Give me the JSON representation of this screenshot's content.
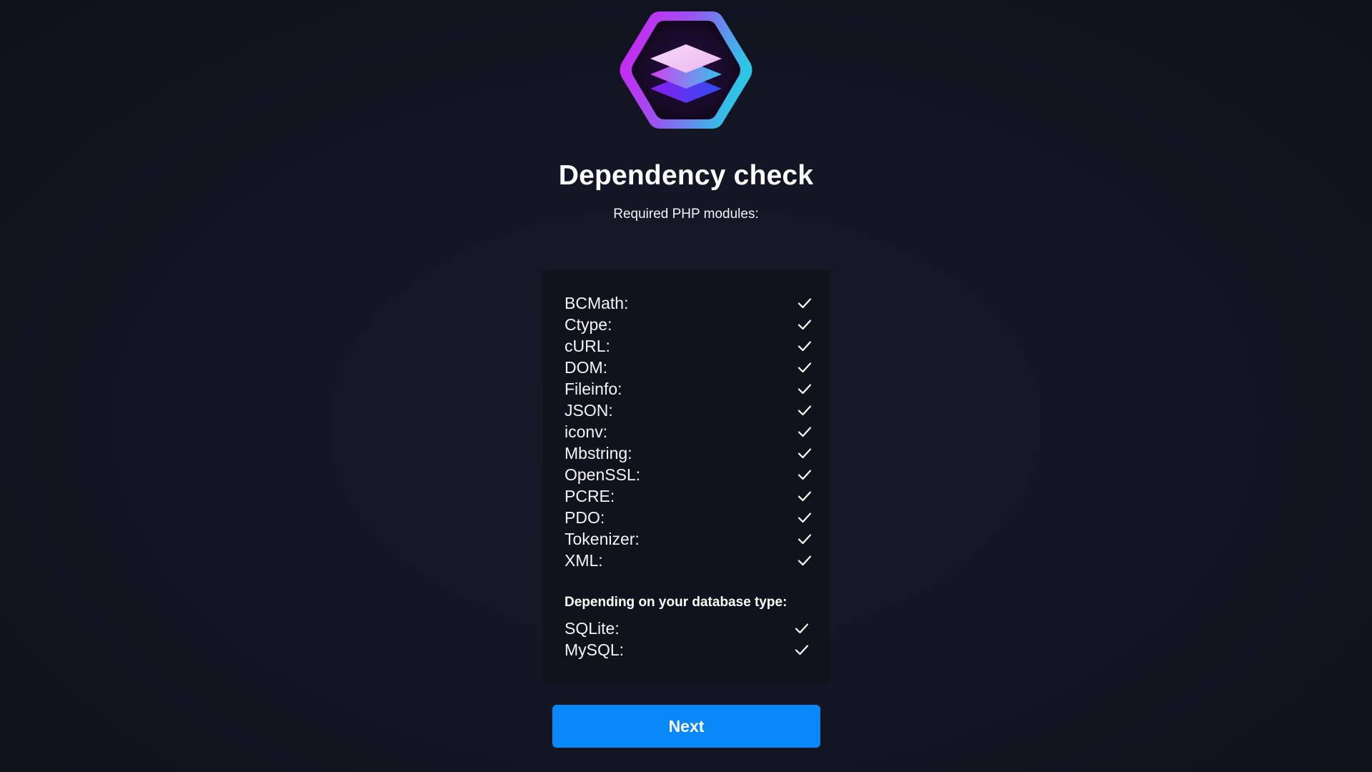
{
  "header": {
    "logo_icon": "layers-hexagon-icon",
    "title": "Dependency check",
    "subtitle": "Required PHP modules:"
  },
  "modules": [
    {
      "name": "BCMath:",
      "status": "check-icon"
    },
    {
      "name": "Ctype:",
      "status": "check-icon"
    },
    {
      "name": "cURL:",
      "status": "check-icon"
    },
    {
      "name": "DOM:",
      "status": "check-icon"
    },
    {
      "name": "Fileinfo:",
      "status": "check-icon"
    },
    {
      "name": "JSON:",
      "status": "check-icon"
    },
    {
      "name": "iconv:",
      "status": "check-icon"
    },
    {
      "name": "Mbstring:",
      "status": "check-icon"
    },
    {
      "name": "OpenSSL:",
      "status": "check-icon"
    },
    {
      "name": "PCRE:",
      "status": "check-icon"
    },
    {
      "name": "PDO:",
      "status": "check-icon"
    },
    {
      "name": "Tokenizer:",
      "status": "check-icon"
    },
    {
      "name": "XML:",
      "status": "check-icon"
    }
  ],
  "database": {
    "heading": "Depending on your database type:",
    "items": [
      {
        "name": "SQLite:",
        "status": "check-icon"
      },
      {
        "name": "MySQL:",
        "status": "check-icon"
      }
    ]
  },
  "actions": {
    "next_label": "Next"
  },
  "colors": {
    "background": "#131624",
    "panel": "#10121c",
    "primary_button": "#0a88f7",
    "text": "#ffffff"
  }
}
